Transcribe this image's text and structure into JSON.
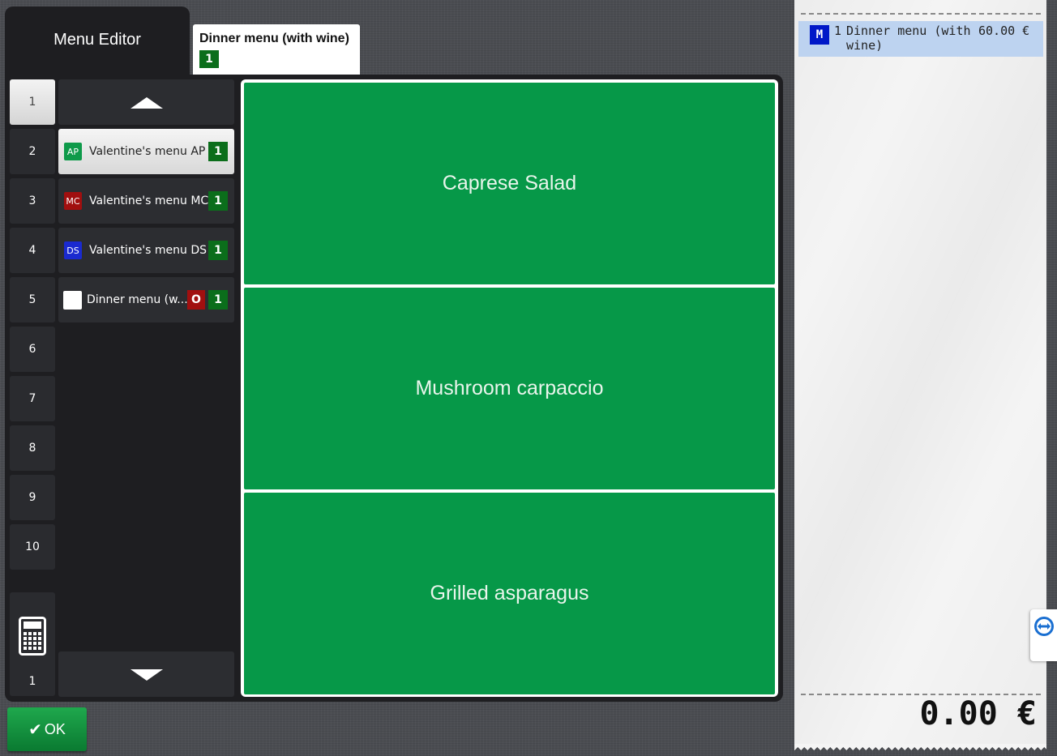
{
  "header": {
    "editor_title": "Menu Editor",
    "active_menu_tab": {
      "label": "Dinner menu (with wine)",
      "count": "1"
    }
  },
  "number_buttons": [
    "1",
    "2",
    "3",
    "4",
    "5",
    "6",
    "7",
    "8",
    "9",
    "10"
  ],
  "active_number": "1",
  "calculator": {
    "icon": "calculator-icon",
    "value": "1"
  },
  "menu_list": [
    {
      "badge": "AP",
      "badge_color": "#0e9a4a",
      "label": "Valentine's menu AP",
      "count": "1",
      "selected": true
    },
    {
      "badge": "MC",
      "badge_color": "#a10f0f",
      "label": "Valentine's menu MC",
      "count": "1",
      "selected": false
    },
    {
      "badge": "DS",
      "badge_color": "#1a2ad0",
      "label": "Valentine's menu DS",
      "count": "1",
      "selected": false
    },
    {
      "badge": "",
      "badge_color": "#ffffff",
      "label": "Dinner menu (w...",
      "option": "O",
      "count": "1",
      "selected": false
    }
  ],
  "dishes": [
    "Caprese Salad",
    "Mushroom carpaccio",
    "Grilled asparagus"
  ],
  "ok_button": {
    "label": "OK",
    "icon": "check-icon"
  },
  "receipt": {
    "lines": [
      {
        "badge": "M",
        "qty": "1",
        "name": "Dinner menu (with wine)",
        "price": "60.00 €"
      }
    ],
    "total": "0.00 €"
  },
  "colors": {
    "dish_green": "#069848",
    "count_green": "#0b6e1b",
    "receipt_highlight": "#bdd3f0"
  }
}
